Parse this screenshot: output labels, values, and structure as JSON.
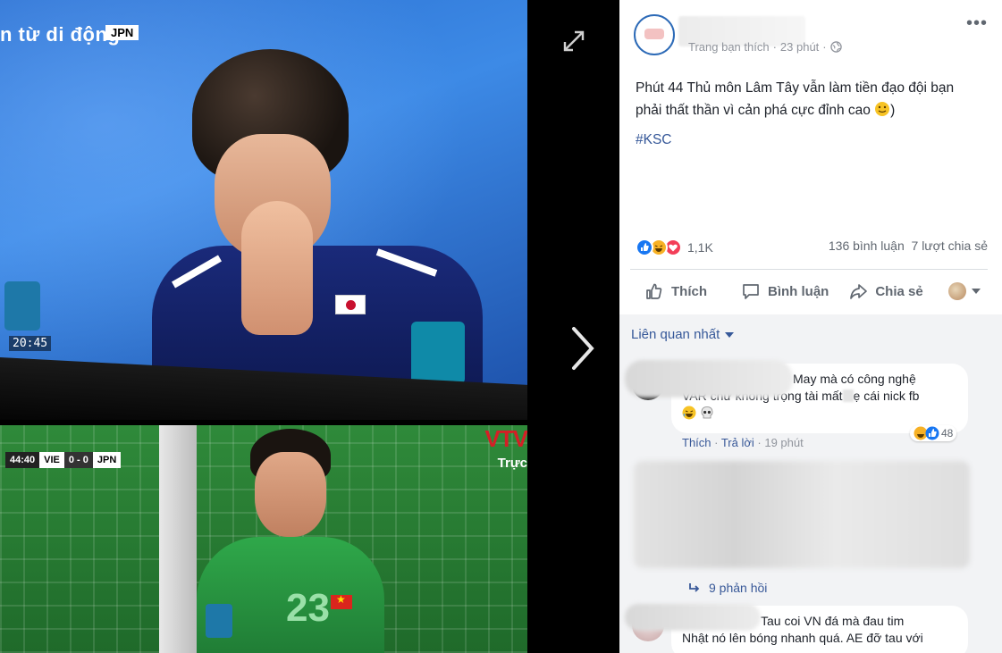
{
  "viewer": {
    "top_caption": "n từ di động",
    "top_chip": "JPN",
    "clock": "20:45",
    "scoreboard": {
      "time": "44:40",
      "home": "VIE",
      "score": "0 - 0",
      "away": "JPN"
    },
    "broadcaster": "VTV",
    "broadcast_sub": "Trực",
    "shirt_number": "23"
  },
  "post": {
    "meta_source": "Trang bạn thích",
    "meta_time": "23 phút",
    "text_line1": "Phút 44 Thủ môn Lâm Tây vẫn làm tiền đạo đội bạn",
    "text_line2": "phải thất thần vì cản phá cực đỉnh cao",
    "text_tail": ")",
    "hashtag": "#KSC",
    "reaction_count": "1,1K",
    "comments_count": "136 bình luận",
    "shares_count": "7 lượt chia sẻ"
  },
  "actions": {
    "like": "Thích",
    "comment": "Bình luận",
    "share": "Chia sẻ"
  },
  "comments": {
    "sort_label": "Liên quan nhất",
    "first": {
      "line1": "May mà có công nghệ",
      "line2a": "VAR chứ không trọng tài mất",
      "line2b": "ẹ cái nick fb",
      "like": "Thích",
      "reply": "Trả lời",
      "time": "19 phút",
      "reaction_count": "48"
    },
    "replies_label": "9 phản hồi",
    "third": {
      "line1": "Tau coi VN đá mà đau tim",
      "line2": "Nhật nó lên bóng nhanh quá. AE đỡ tau với"
    }
  },
  "colors": {
    "link": "#365899",
    "muted": "#90949c",
    "like_blue": "#1877f2",
    "love_red": "#f33e58",
    "haha_yellow": "#f7b125"
  }
}
